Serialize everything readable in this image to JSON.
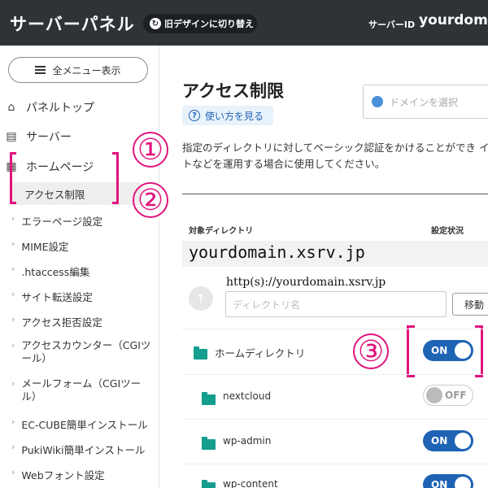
{
  "header": {
    "title": "サーバーパネル",
    "switch_label": "旧デザインに切り替え",
    "server_id_label": "サーバーID",
    "server_id_value": "yourdomai"
  },
  "sidebar": {
    "all_menu_label": "全メニュー表示",
    "items": [
      {
        "label": "パネルトップ",
        "icon": "home-icon"
      },
      {
        "label": "サーバー",
        "icon": "server-icon"
      },
      {
        "label": "ホームページ",
        "icon": "calendar-icon"
      }
    ],
    "sub_items": [
      "アクセス制限",
      "エラーページ設定",
      "MIME設定",
      ".htaccess編集",
      "サイト転送設定",
      "アクセス拒否設定",
      "アクセスカウンター（CGIツール）",
      "メールフォーム（CGIツール）",
      "EC-CUBE簡単インストール",
      "PukiWiki簡単インストール",
      "Webフォント設定"
    ]
  },
  "annotations": [
    "①",
    "②",
    "③"
  ],
  "main": {
    "title": "アクセス制限",
    "howto_label": "使い方を見る",
    "domain_placeholder": "ドメインを選択",
    "description": "指定のディレクトリに対してベーシック認証をかけることができ イトなどを運用する場合に使用してください。",
    "col_directory": "対象ディレクトリ",
    "col_status": "設定状況",
    "domain": "yourdomain.xsrv.jp",
    "url_hint": "http(s)://yourdomain.xsrv.jp",
    "dir_placeholder": "ディレクトリ名",
    "move_label": "移動",
    "rows": [
      {
        "label": "ホームディレクトリ",
        "status": "ON"
      },
      {
        "label": "nextcloud",
        "status": "OFF"
      },
      {
        "label": "wp-admin",
        "status": "ON"
      },
      {
        "label": "wp-content",
        "status": "ON"
      }
    ]
  },
  "colors": {
    "header_bg": "#2e3338",
    "accent_blue": "#1f63b5",
    "folder_teal": "#159d8e",
    "annotation_pink": "#e0147c"
  }
}
